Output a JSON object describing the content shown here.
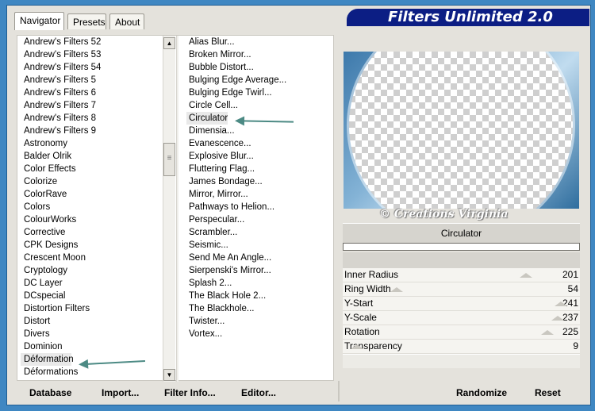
{
  "tabs": [
    {
      "label": "Navigator",
      "active": true
    },
    {
      "label": "Presets",
      "active": false
    },
    {
      "label": "About",
      "active": false
    }
  ],
  "banner_title": "Filters Unlimited 2.0",
  "categories": [
    "Andrew's Filters 52",
    "Andrew's Filters 53",
    "Andrew's Filters 54",
    "Andrew's Filters 5",
    "Andrew's Filters 6",
    "Andrew's Filters 7",
    "Andrew's Filters 8",
    "Andrew's Filters 9",
    "Astronomy",
    "Balder Olrik",
    "Color Effects",
    "Colorize",
    "ColorRave",
    "Colors",
    "ColourWorks",
    "Corrective",
    "CPK Designs",
    "Crescent Moon",
    "Cryptology",
    "DC Layer",
    "DCspecial",
    "Distortion Filters",
    "Distort",
    "Divers",
    "Dominion",
    "Déformation",
    "Déformations"
  ],
  "selected_category": "Déformation",
  "filters": [
    "Alias Blur...",
    "Broken Mirror...",
    "Bubble Distort...",
    "Bulging Edge Average...",
    "Bulging Edge Twirl...",
    "Circle Cell...",
    "Circulator",
    "Dimensia...",
    "Evanescence...",
    "Explosive Blur...",
    "Fluttering Flag...",
    "James Bondage...",
    "Mirror, Mirror...",
    "Pathways to Helion...",
    "Perspecular...",
    "Scrambler...",
    "Seismic...",
    "Send Me An Angle...",
    "Sierpenski's Mirror...",
    "Splash 2...",
    "The Black Hole 2...",
    "The Blackhole...",
    "Twister...",
    "Vortex..."
  ],
  "selected_filter": "Circulator",
  "watermark": "© Creations Virginia",
  "filter_name": "Circulator",
  "params": [
    {
      "name": "Inner Radius",
      "value": "201",
      "level": 201
    },
    {
      "name": "Ring Width",
      "value": "54",
      "level": 54
    },
    {
      "name": "Y-Start",
      "value": "241",
      "level": 241
    },
    {
      "name": "Y-Scale",
      "value": "237",
      "level": 237
    },
    {
      "name": "Rotation",
      "value": "225",
      "level": 225
    },
    {
      "name": "Transparency",
      "value": "9",
      "level": 9
    }
  ],
  "param_max": 255,
  "buttons": {
    "database": "Database",
    "import": "Import...",
    "filter_info": "Filter Info...",
    "editor": "Editor...",
    "randomize": "Randomize",
    "reset": "Reset"
  },
  "colors": {
    "desktop": "#3f87c2",
    "banner": "#0c1e84",
    "arrow": "#4c8a84"
  }
}
